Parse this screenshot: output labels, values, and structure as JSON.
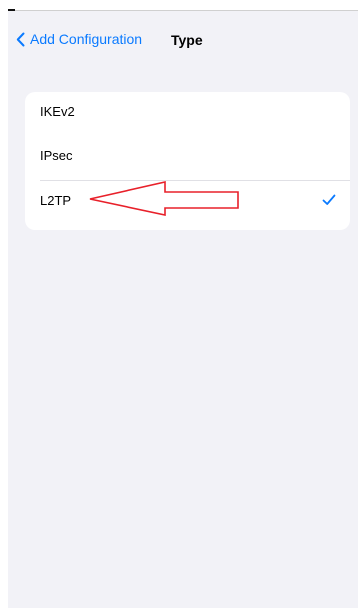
{
  "nav": {
    "back_label": "Add Configuration",
    "back_icon": "chevron-left-icon",
    "title": "Type"
  },
  "vpn_types": [
    {
      "label": "IKEv2",
      "selected": false
    },
    {
      "label": "IPsec",
      "selected": false
    },
    {
      "label": "L2TP",
      "selected": true
    }
  ],
  "colors": {
    "accent": "#0a7aff",
    "background": "#f2f2f7",
    "annotation": "#e8202a"
  },
  "annotation": {
    "type": "arrow",
    "points_to": "L2TP"
  }
}
